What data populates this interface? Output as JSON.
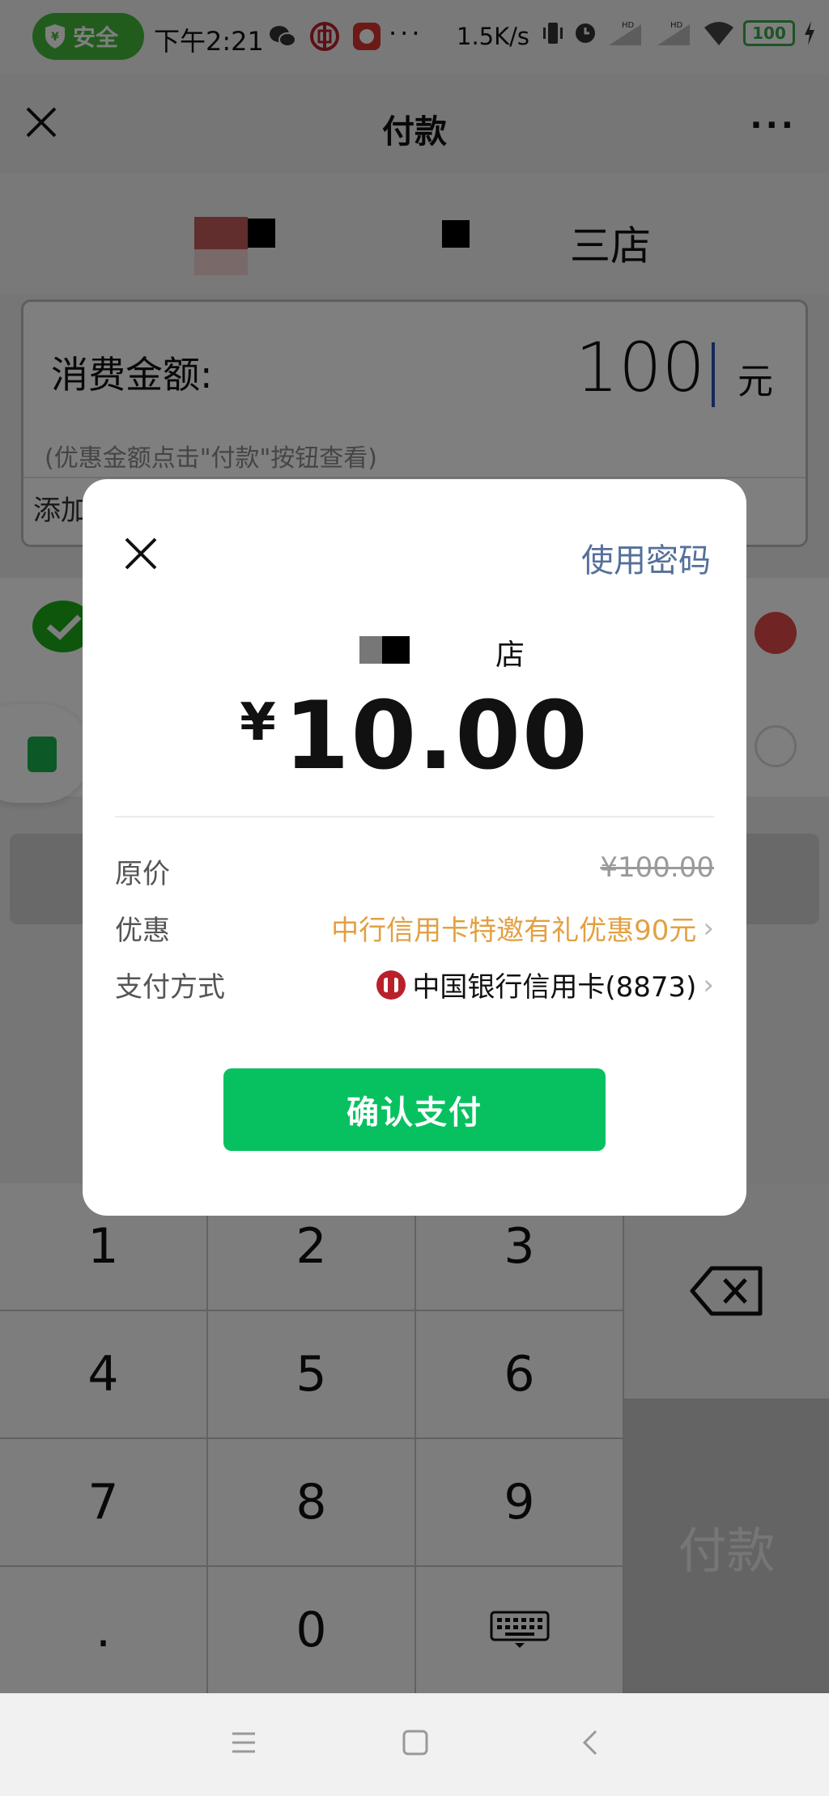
{
  "status_bar": {
    "safe_label": "安全",
    "time": "下午2:21",
    "more": "···",
    "net_speed": "1.5K/s",
    "battery": "100"
  },
  "nav": {
    "title": "付款",
    "more": "···"
  },
  "page": {
    "merchant_name_partial": "三店",
    "amount_label": "消费金额:",
    "amount_value": "100",
    "amount_unit": "元",
    "hint": "(优惠金额点击\"付款\"按钮查看)",
    "add_note_partial": "添加"
  },
  "keypad": {
    "keys": [
      "1",
      "2",
      "3",
      "4",
      "5",
      "6",
      "7",
      "8",
      "9",
      ".",
      "0"
    ],
    "pay_label": "付款"
  },
  "dialog": {
    "password_link": "使用密码",
    "merchant_name_partial": "店",
    "currency": "¥",
    "amount": "10.00",
    "rows": {
      "original_label": "原价",
      "original_value": "¥100.00",
      "discount_label": "优惠",
      "discount_value": "中行信用卡特邀有礼优惠90元",
      "method_label": "支付方式",
      "method_value": "中国银行信用卡(8873)"
    },
    "confirm_label": "确认支付"
  },
  "colors": {
    "wechat_green": "#07c160",
    "discount_orange": "#e2a042",
    "link_blue": "#55709a",
    "boc_red": "#b8202a"
  }
}
